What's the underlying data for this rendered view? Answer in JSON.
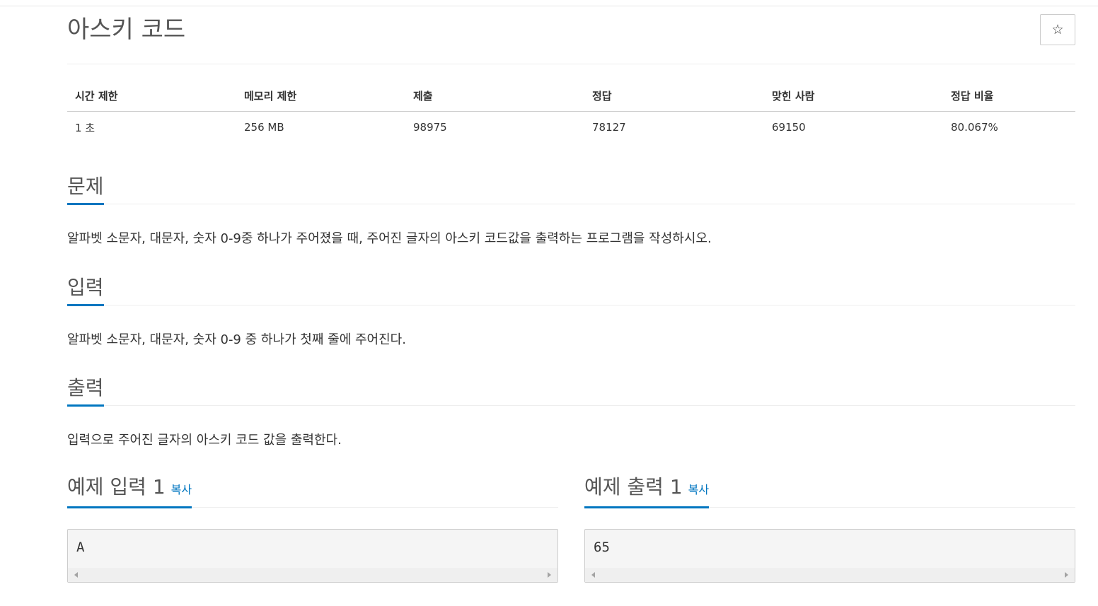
{
  "problem": {
    "title": "아스키 코드",
    "star_icon": "star-outline-icon"
  },
  "info_table": {
    "headers": [
      "시간 제한",
      "메모리 제한",
      "제출",
      "정답",
      "맞힌 사람",
      "정답 비율"
    ],
    "values": [
      "1 초",
      "256 MB",
      "98975",
      "78127",
      "69150",
      "80.067%"
    ]
  },
  "sections": {
    "description": {
      "title": "문제",
      "text": "알파벳 소문자, 대문자, 숫자 0-9중 하나가 주어졌을 때, 주어진 글자의 아스키 코드값을 출력하는 프로그램을 작성하시오."
    },
    "input": {
      "title": "입력",
      "text": "알파벳 소문자, 대문자, 숫자 0-9 중 하나가 첫째 줄에 주어진다."
    },
    "output": {
      "title": "출력",
      "text": "입력으로 주어진 글자의 아스키 코드 값을 출력한다."
    }
  },
  "samples": {
    "input": {
      "title": "예제 입력 1",
      "copy_label": "복사",
      "content": "A"
    },
    "output": {
      "title": "예제 출력 1",
      "copy_label": "복사",
      "content": "65"
    }
  },
  "colors": {
    "accent": "#0076c0",
    "sample_bg": "#f5f5f5"
  }
}
